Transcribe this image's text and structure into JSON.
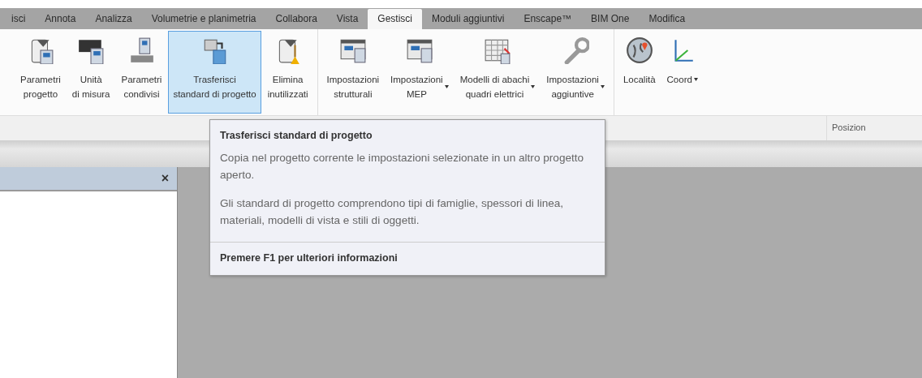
{
  "tabs": [
    {
      "label": "isci",
      "selected": false
    },
    {
      "label": "Annota",
      "selected": false
    },
    {
      "label": "Analizza",
      "selected": false
    },
    {
      "label": "Volumetrie e planimetria",
      "selected": false
    },
    {
      "label": "Collabora",
      "selected": false
    },
    {
      "label": "Vista",
      "selected": false
    },
    {
      "label": "Gestisci",
      "selected": true
    },
    {
      "label": "Moduli aggiuntivi",
      "selected": false
    },
    {
      "label": "Enscape™",
      "selected": false
    },
    {
      "label": "BIM One",
      "selected": false
    },
    {
      "label": "Modifica",
      "selected": false
    }
  ],
  "ribbon": {
    "groups": [
      {
        "buttons": [
          {
            "lines": [
              "Parametri",
              "progetto"
            ],
            "selected": false,
            "dropdown": false
          },
          {
            "lines": [
              "Unità",
              "di misura"
            ],
            "selected": false,
            "dropdown": false
          },
          {
            "lines": [
              "Parametri",
              "condivisi"
            ],
            "selected": false,
            "dropdown": false
          },
          {
            "lines": [
              "Trasferisci",
              "standard di progetto"
            ],
            "selected": true,
            "dropdown": false
          },
          {
            "lines": [
              "Elimina",
              "inutilizzati"
            ],
            "selected": false,
            "dropdown": false
          }
        ]
      },
      {
        "buttons": [
          {
            "lines": [
              "Impostazioni",
              "strutturali"
            ],
            "selected": false,
            "dropdown": false
          },
          {
            "lines": [
              "Impostazioni",
              "MEP"
            ],
            "selected": false,
            "dropdown": true
          },
          {
            "lines": [
              "Modelli di abachi",
              "quadri elettrici"
            ],
            "selected": false,
            "dropdown": true
          },
          {
            "lines": [
              "Impostazioni",
              "aggiuntive"
            ],
            "selected": false,
            "dropdown": true
          }
        ]
      },
      {
        "label": "Posizion",
        "buttons": [
          {
            "lines": [
              "Località"
            ],
            "selected": false,
            "dropdown": false
          },
          {
            "lines": [
              "Coord"
            ],
            "selected": false,
            "dropdown": true
          }
        ]
      }
    ]
  },
  "tooltip": {
    "title": "Trasferisci standard di progetto",
    "paragraphs": [
      "Copia nel progetto corrente le impostazioni selezionate in un altro progetto aperto.",
      "Gli standard di progetto comprendono tipi di famiglie, spessori di linea, materiali, modelli di vista e stili di oggetti."
    ],
    "footer": "Premere F1 per ulteriori informazioni"
  },
  "properties_panel": {
    "close": "×"
  }
}
